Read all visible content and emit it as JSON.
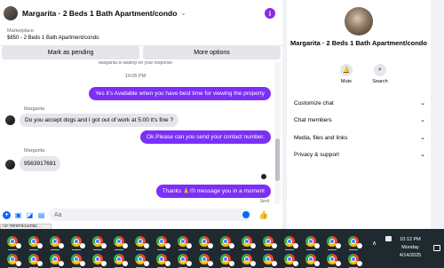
{
  "chat": {
    "title": "Margarita · 2 Beds 1 Bath Apartment/condo",
    "info_icon": "i",
    "listing_kind": "Marketplace",
    "listing_title": "$850 - 2 Beds 1 Bath Apartment/condo",
    "buttons": {
      "mark_pending": "Mark as pending",
      "more_options": "More options"
    },
    "cut_text": "Margarita is waiting for your response",
    "timestamp": "10:05 PM",
    "messages": [
      {
        "from": "me",
        "text": "Yes it's Available when you have best time for viewing the property"
      },
      {
        "from": "them",
        "sender": "Margarita",
        "text": "Do you accept dogs and I got out of work at 5:00 it's fine ?"
      },
      {
        "from": "me",
        "text": "Ok.Please can you send your contact number."
      },
      {
        "from": "them",
        "sender": "Margarita",
        "text": "9563917691"
      },
      {
        "from": "me",
        "text": "Thanks 🙏I'll message you in a moment"
      }
    ],
    "sent_label": "Sent",
    "composer_placeholder": "Aa",
    "status_url": "79/?referralSurfac..."
  },
  "side": {
    "name": "Margarita · 2 Beds 1 Bath Apartment/condo",
    "mute_label": "Mute",
    "search_label": "Search",
    "rows": [
      "Customize chat",
      "Chat members",
      "Media, files and links",
      "Privacy & support"
    ]
  },
  "taskbar": {
    "time": "10:12 PM",
    "day": "Monday",
    "date": "4/14/2025",
    "app_count": 34
  },
  "colors": {
    "accent_purple": "#7b2ff7",
    "brand_blue": "#0866ff",
    "taskbar_bg": "#1f2a30"
  }
}
